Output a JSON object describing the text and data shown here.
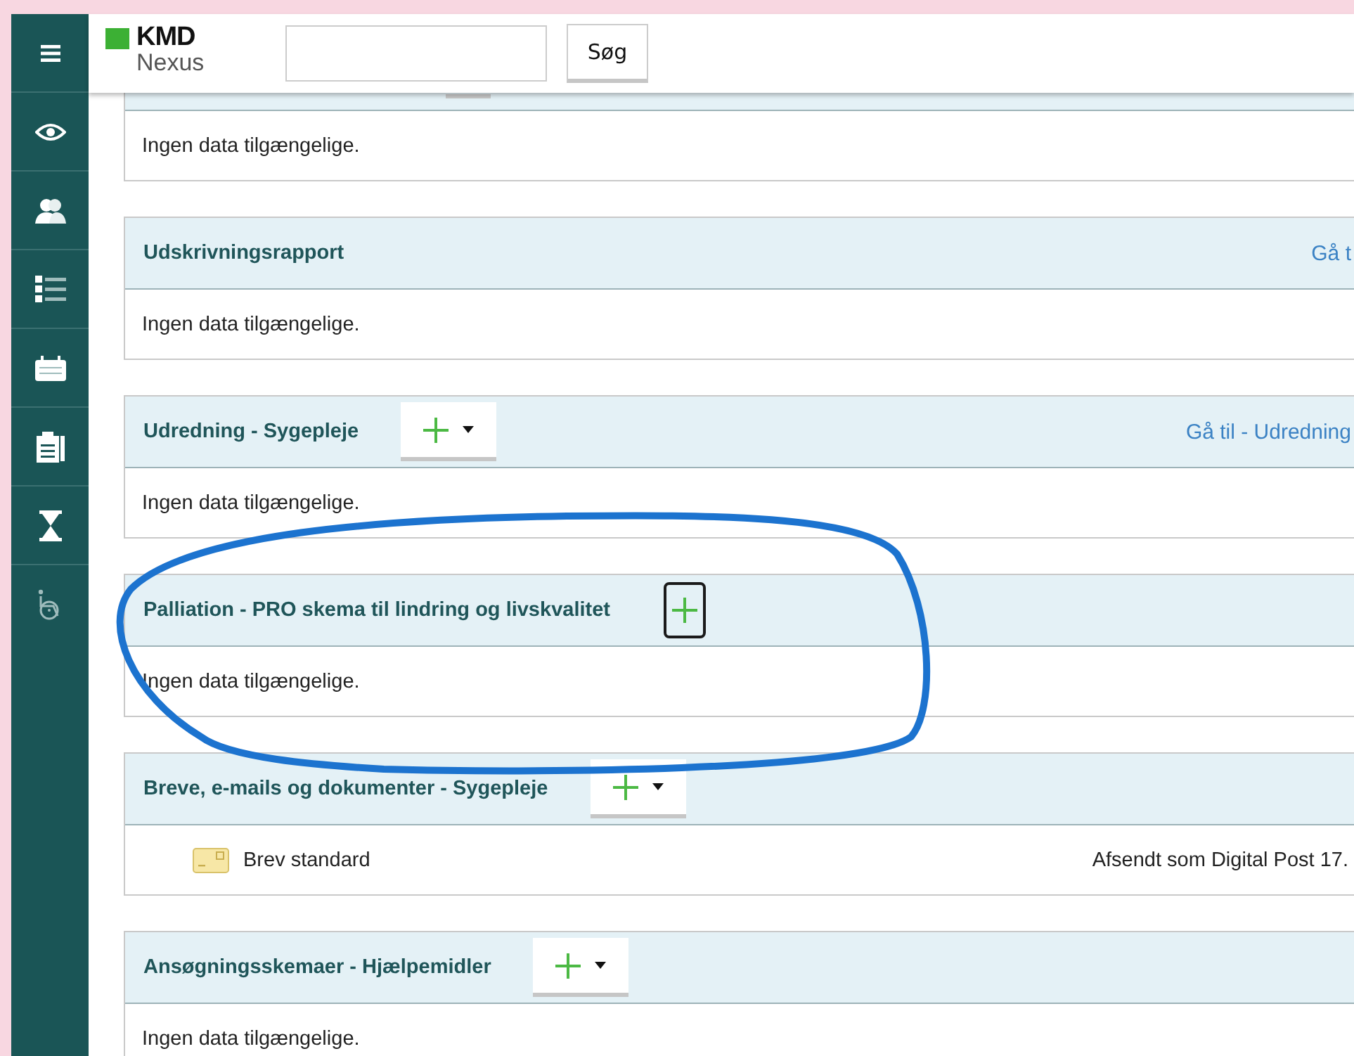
{
  "header": {
    "logo": {
      "brand": "KMD",
      "product": "Nexus"
    },
    "search": {
      "button": "Søg"
    }
  },
  "sections": [
    {
      "kind": "cut_off",
      "circled": false,
      "rows": [
        {
          "kind": "empty",
          "text": "Ingen data tilgængelige."
        }
      ]
    },
    {
      "kind": "full",
      "title": "Udskrivningsrapport",
      "link": "Gå t",
      "circled": false,
      "rows": [
        {
          "kind": "empty",
          "text": "Ingen data tilgængelige."
        }
      ]
    },
    {
      "kind": "full",
      "title": "Udredning - Sygepleje",
      "add_button": {
        "kind": "plus_dropdown",
        "focused": false
      },
      "link": "Gå til - Udredning",
      "circled": false,
      "rows": [
        {
          "kind": "empty",
          "text": "Ingen data tilgængelige."
        }
      ]
    },
    {
      "kind": "full",
      "title": "Palliation - PRO skema til lindring og livskvalitet",
      "add_button": {
        "kind": "plus",
        "focused": true
      },
      "circled": true,
      "rows": [
        {
          "kind": "empty",
          "text": "Ingen data tilgængelige."
        }
      ]
    },
    {
      "kind": "full",
      "title": "Breve, e-mails og dokumenter - Sygepleje",
      "add_button": {
        "kind": "plus_dropdown",
        "focused": false
      },
      "circled": false,
      "rows": [
        {
          "kind": "document",
          "name": "Brev standard",
          "status": "Afsendt som Digital Post 17."
        }
      ]
    },
    {
      "kind": "full",
      "title": "Ansøgningsskemaer - Hjælpemidler",
      "add_button": {
        "kind": "plus_dropdown",
        "focused": false
      },
      "circled": false,
      "rows": [
        {
          "kind": "empty",
          "text": "Ingen data tilgængelige."
        }
      ]
    }
  ]
}
